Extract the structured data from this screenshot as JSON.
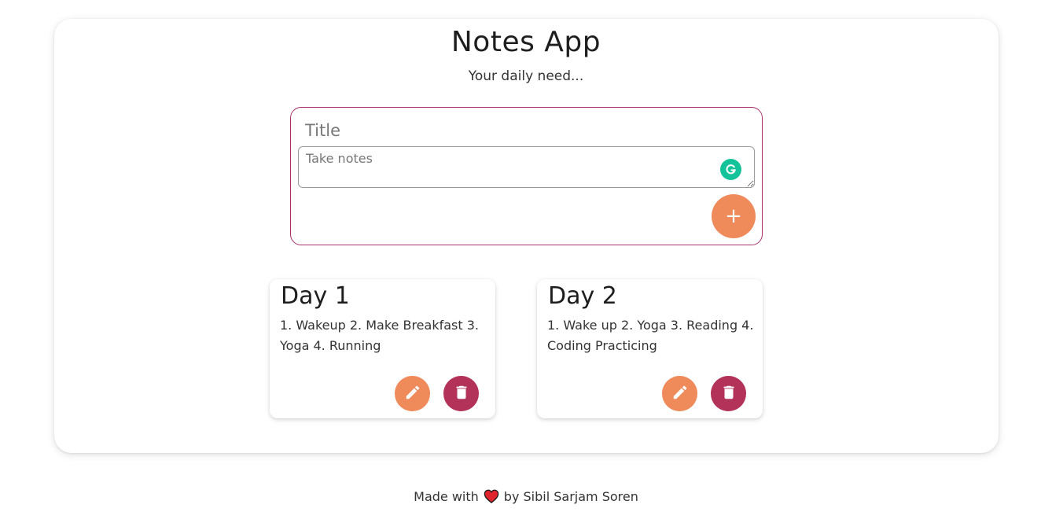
{
  "header": {
    "title": "Notes App",
    "subtitle": "Your daily need..."
  },
  "composer": {
    "title_placeholder": "Title",
    "notes_placeholder": "Take notes",
    "add_label": "+",
    "border_color": "#a8326e",
    "add_button_color": "#ef8a5b",
    "grammarly_icon": "grammarly-icon"
  },
  "notes": [
    {
      "title": "Day 1",
      "body": "1. Wakeup 2. Make Breakfast 3. Yoga 4. Running"
    },
    {
      "title": "Day 2",
      "body": "1. Wake up 2. Yoga 3. Reading 4. Coding Practicing"
    }
  ],
  "note_actions": {
    "edit_icon": "pencil-icon",
    "delete_icon": "trash-icon",
    "edit_color": "#ef8a5b",
    "delete_color": "#b3325a"
  },
  "footer": {
    "prefix": "Made with",
    "suffix": "by Sibil Sarjam Soren",
    "heart_icon": "heart-icon"
  }
}
